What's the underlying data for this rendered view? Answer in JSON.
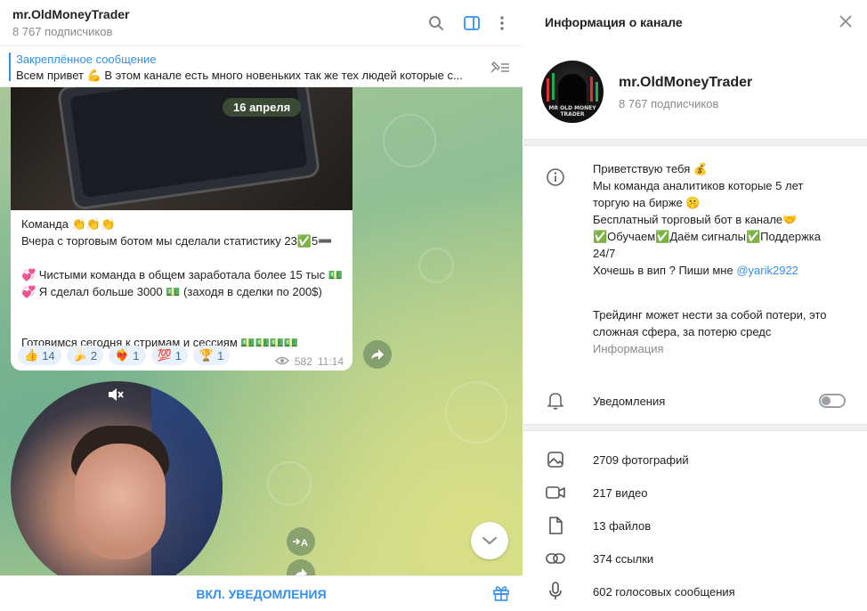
{
  "chat": {
    "title": "mr.OldMoneyTrader",
    "subtitle": "8 767 подписчиков",
    "pinned_title": "Закреплённое сообщение",
    "pinned_text": "Всем привет 💪 В этом канале есть много новеньких так же тех людей которые с...",
    "date_pill": "16 апреля",
    "message_lines": [
      "Команда 👏👏👏",
      "Вчера с торговым ботом мы сделали статистику 23✅5➖",
      "",
      "💞 Чистыми команда в общем заработала более 15 тыс 💵",
      "💞 Я сделал больше 3000 💵 (заходя в сделки по 200$)",
      "",
      "",
      "Готовимся сегодня к стримам и сессиям 💵💵💵💵"
    ],
    "reactions": [
      {
        "emoji": "👍",
        "count": "14"
      },
      {
        "emoji": "🍌",
        "count": "2"
      },
      {
        "emoji": "❤️‍🔥",
        "count": "1"
      },
      {
        "emoji": "💯",
        "count": "1"
      },
      {
        "emoji": "🏆",
        "count": "1"
      }
    ],
    "views": "582",
    "time": "11:14",
    "notify_button": "ВКЛ. УВЕДОМЛЕНИЯ"
  },
  "info": {
    "header_title": "Информация о канале",
    "name": "mr.OldMoneyTrader",
    "subscribers": "8 767 подписчиков",
    "avatar_text": "MR OLD MONEY TRADER",
    "description_lines": [
      "Приветствую тебя 💰",
      "Мы команда аналитиков которые 5 лет",
      "торгую на бирже 🤫",
      "Бесплатный торговый бот в канале🤝",
      "✅Обучаем✅Даём сигналы✅Поддержка",
      "24/7"
    ],
    "vip_text": "Хочешь в вип ? Пиши мне ",
    "vip_link": "@yarik2922",
    "risk_lines": [
      "Трейдинг может нести за собой потери, это",
      "сложная сфера, за потерю средс"
    ],
    "desc_caption": "Информация",
    "notifications_label": "Уведомления",
    "notifications_enabled": false,
    "media": [
      {
        "icon": "photo-icon",
        "label": "2709 фотографий"
      },
      {
        "icon": "video-icon",
        "label": "217 видео"
      },
      {
        "icon": "file-icon",
        "label": "13 файлов"
      },
      {
        "icon": "link-icon",
        "label": "374 ссылки"
      },
      {
        "icon": "microphone-icon",
        "label": "602 голосовых сообщения"
      }
    ]
  },
  "colors": {
    "accent": "#3390ec",
    "secondary_text": "#8a8a8a"
  }
}
